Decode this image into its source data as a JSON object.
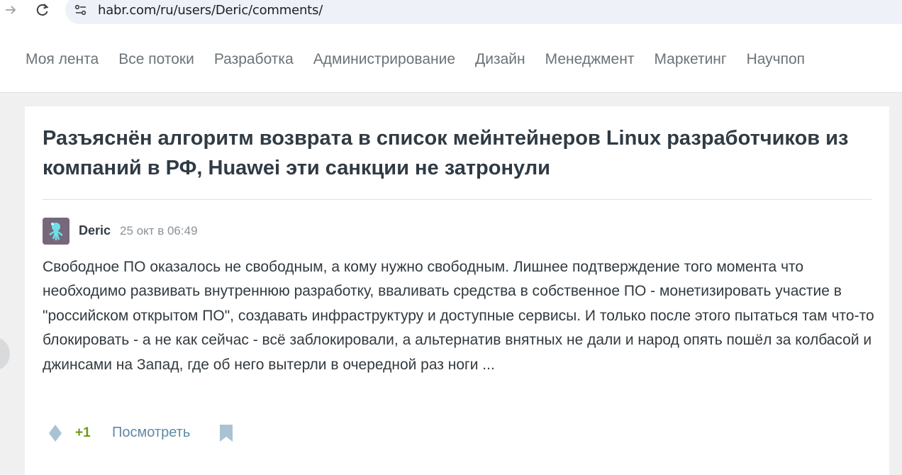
{
  "browser": {
    "url": "habr.com/ru/users/Deric/comments/"
  },
  "nav": {
    "items": [
      "Моя лента",
      "Все потоки",
      "Разработка",
      "Администрирование",
      "Дизайн",
      "Менеджмент",
      "Маркетинг",
      "Научпоп"
    ]
  },
  "article": {
    "title": "Разъяснён алгоритм возврата в список мейнтейнеров Linux разработчиков из компаний в РФ, Huawei эти санкции не затронули"
  },
  "comment": {
    "author": "Deric",
    "date": "25 окт в 06:49",
    "text": "Свободное ПО оказалось не свободным, а кому нужно свободным. Лишнее подтверждение того момента что необходимо развивать внутреннюю разработку, вваливать средства в собственное ПО - монетизировать участие в \"российском открытом ПО\", создавать инфраструктуру и доступные сервисы. И только после этого пытаться там что-то блокировать - а не как сейчас - всё заблокировали, а альтернатив внятных не дали и народ опять пошёл за колбасой и джинсами на Запад, где об него вытерли в очередной раз ноги ...",
    "score": "+1",
    "view_label": "Посмотреть"
  },
  "colors": {
    "score": "#6c9a12",
    "link": "#5e8aa6",
    "icon": "#a9c3d3"
  },
  "icons": {
    "back": "arrow-right-icon",
    "reload": "reload-icon",
    "site_settings": "site-settings-icon",
    "vote": "vote-diamond-icon",
    "bookmark": "bookmark-icon"
  }
}
